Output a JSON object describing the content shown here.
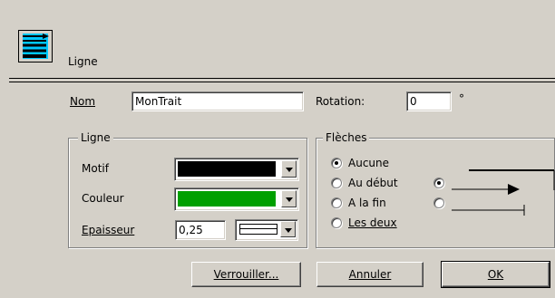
{
  "header": {
    "title": "Ligne",
    "icon": "line-style-icon"
  },
  "fields": {
    "nom": {
      "label": "Nom",
      "value": "MonTrait"
    },
    "rotation": {
      "label": "Rotation:",
      "value": "0",
      "unit": "°"
    }
  },
  "ligne_group": {
    "title": "Ligne",
    "motif": {
      "label": "Motif",
      "color": "#000000"
    },
    "couleur": {
      "label": "Couleur",
      "color": "#00a000"
    },
    "epaisseur": {
      "label": "Epaisseur",
      "value": "0,25"
    }
  },
  "fleches_group": {
    "title": "Flèches",
    "options": [
      {
        "label": "Aucune",
        "checked": true
      },
      {
        "label": "Au début",
        "checked": false
      },
      {
        "label": "A la fin",
        "checked": false
      },
      {
        "label": "Les deux",
        "checked": false
      }
    ]
  },
  "buttons": {
    "lock": "Verrouiller...",
    "cancel": "Annuler",
    "ok": "OK"
  }
}
